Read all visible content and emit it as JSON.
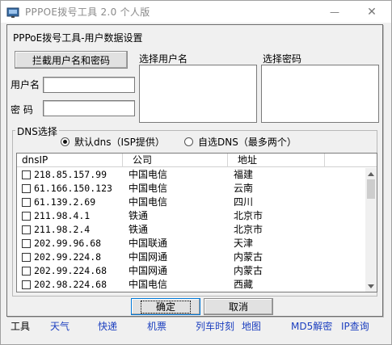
{
  "main_window": {
    "title": "PPPOE拨号工具 2.0 个人版",
    "minimize_glyph": "—",
    "close_glyph": "✕"
  },
  "dialog": {
    "title": "PPPoE拨号工具-用户数据设置",
    "intercept_button": "拦截用户名和密码",
    "username_label": "用户名",
    "username_value": "",
    "password_label": "密 码",
    "password_value": "",
    "select_user_label": "选择用户名",
    "select_password_label": "选择密码",
    "dns_group_label": "DNS选择",
    "radio_default": "默认dns（ISP提供）",
    "radio_custom": "自选DNS（最多两个）",
    "radio_default_selected": true,
    "columns": [
      "dnsIP",
      "公司",
      "地址"
    ],
    "rows": [
      {
        "ip": "218.85.157.99",
        "company": "中国电信",
        "location": "福建"
      },
      {
        "ip": "61.166.150.123",
        "company": "中国电信",
        "location": "云南"
      },
      {
        "ip": "61.139.2.69",
        "company": "中国电信",
        "location": "四川"
      },
      {
        "ip": "211.98.4.1",
        "company": "铁通",
        "location": "北京市"
      },
      {
        "ip": "211.98.2.4",
        "company": "铁通",
        "location": "北京市"
      },
      {
        "ip": "202.99.96.68",
        "company": "中国联通",
        "location": "天津"
      },
      {
        "ip": "202.99.224.8",
        "company": "中国网通",
        "location": "内蒙古"
      },
      {
        "ip": "202.99.224.68",
        "company": "中国网通",
        "location": "内蒙古"
      },
      {
        "ip": "202.98.224.68",
        "company": "中国电信",
        "location": "西藏"
      }
    ],
    "ok_button": "确定",
    "cancel_button": "取消"
  },
  "bottom_bar": {
    "tools": "工具",
    "links": [
      "天气",
      "快递",
      "机票",
      "列车时刻",
      "地图",
      "MD5解密",
      "IP查询"
    ]
  },
  "colors": {
    "link": "#1c3fbf",
    "focus_border": "#0078d7"
  },
  "icons": {
    "app": "app-icon",
    "minimize": "minimize-icon",
    "close": "close-icon",
    "scroll_up": "scroll-up-icon",
    "scroll_down": "scroll-down-icon"
  }
}
